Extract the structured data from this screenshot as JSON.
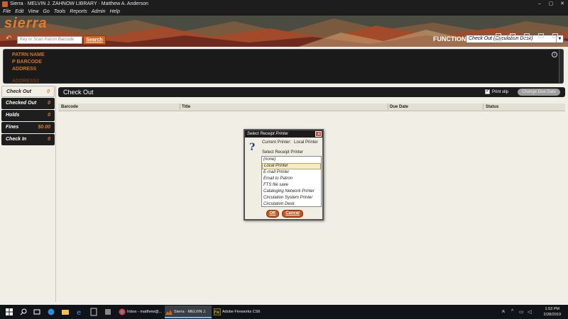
{
  "window": {
    "title": "Sierra · MELVIN J. ZAHNOW LIBRARY · Matthew A. Anderson",
    "controls": [
      "–",
      "▢",
      "✕"
    ]
  },
  "menu": [
    "File",
    "Edit",
    "View",
    "Go",
    "Tools",
    "Reports",
    "Admin",
    "Help"
  ],
  "header": {
    "logo": "sierra",
    "search_placeholder": "Key or Scan Patron Barcode",
    "search_button": "Search",
    "function_label": "FUNCTION",
    "function_value": "Check Out (Circulation Desk)",
    "toolbar": [
      "New",
      "",
      "",
      "",
      ""
    ]
  },
  "patron": {
    "name_label": "PATRN NAME",
    "barcode_label": "P BARCODE",
    "address_label": "ADDRESS",
    "address2_label": "ADDRESS2"
  },
  "nav": [
    {
      "label": "Check Out",
      "count": "0"
    },
    {
      "label": "Checked Out",
      "count": "0"
    },
    {
      "label": "Holds",
      "count": "0"
    },
    {
      "label": "Fines",
      "count": "$0.00"
    },
    {
      "label": "Check In",
      "count": "0"
    }
  ],
  "main": {
    "title": "Check Out",
    "print_slip": "Print slip",
    "print_slip_checked": true,
    "change_due_date": "Change Due Date",
    "columns": [
      "Barcode",
      "Title",
      "Due Date",
      "Status"
    ]
  },
  "dialog": {
    "title": "Select Receipt Printer",
    "current_label": "Current Printer:",
    "current_value": "Local Printer",
    "select_label": "Select Receipt Printer",
    "options": [
      "(none)",
      "Local Printer",
      "E-mail Printer",
      "Email to Patron",
      "FTS file save",
      "Cataloging Network Printer",
      "Circulation System Printer",
      "Circulation Desk"
    ],
    "selected_index": 1,
    "ok": "OK",
    "cancel": "Cancel"
  },
  "taskbar": {
    "apps": [
      "Inbox - matthew@...",
      "Sierra · MELVIN J. Z...",
      "Adobe Fireworks CS6"
    ],
    "time": "1:53 PM",
    "date": "2/28/2019"
  }
}
